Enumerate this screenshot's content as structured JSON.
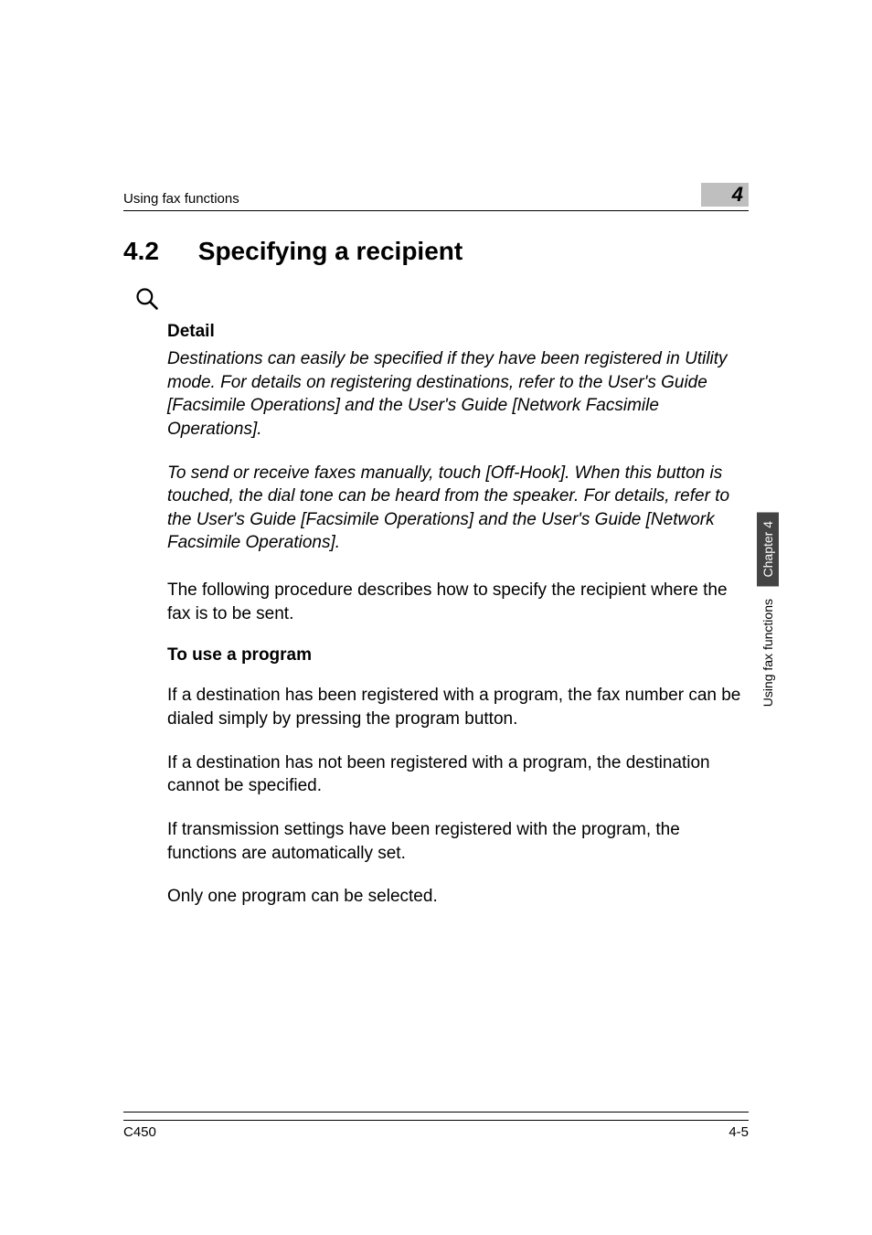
{
  "header": {
    "breadcrumb": "Using fax functions",
    "chapter_number": "4"
  },
  "section": {
    "number": "4.2",
    "title": "Specifying a recipient"
  },
  "detail": {
    "label": "Detail",
    "para1": "Destinations can easily be specified if they have been registered in Utility mode. For details on registering destinations, refer to the User's Guide [Facsimile Operations] and the User's Guide [Network Facsimile Operations].",
    "para2": "To send or receive faxes manually, touch [Off-Hook]. When this button is touched, the dial tone can be heard from the speaker. For details, refer to the User's Guide [Facsimile Operations] and the User's Guide [Network Facsimile Operations]."
  },
  "body": {
    "intro": "The following procedure describes how to specify the recipient where the fax is to be sent.",
    "subheading": "To use a program",
    "para1": "If a destination has been registered with a program, the fax number can be dialed simply by pressing the program button.",
    "para2": "If a destination has not been registered with a program, the destination cannot be specified.",
    "para3": "If transmission settings have been registered with the program, the functions are automatically set.",
    "para4": "Only one program can be selected."
  },
  "side_tabs": {
    "chapter_label": "Chapter 4",
    "section_label": "Using fax functions"
  },
  "footer": {
    "model": "C450",
    "page_number": "4-5"
  }
}
